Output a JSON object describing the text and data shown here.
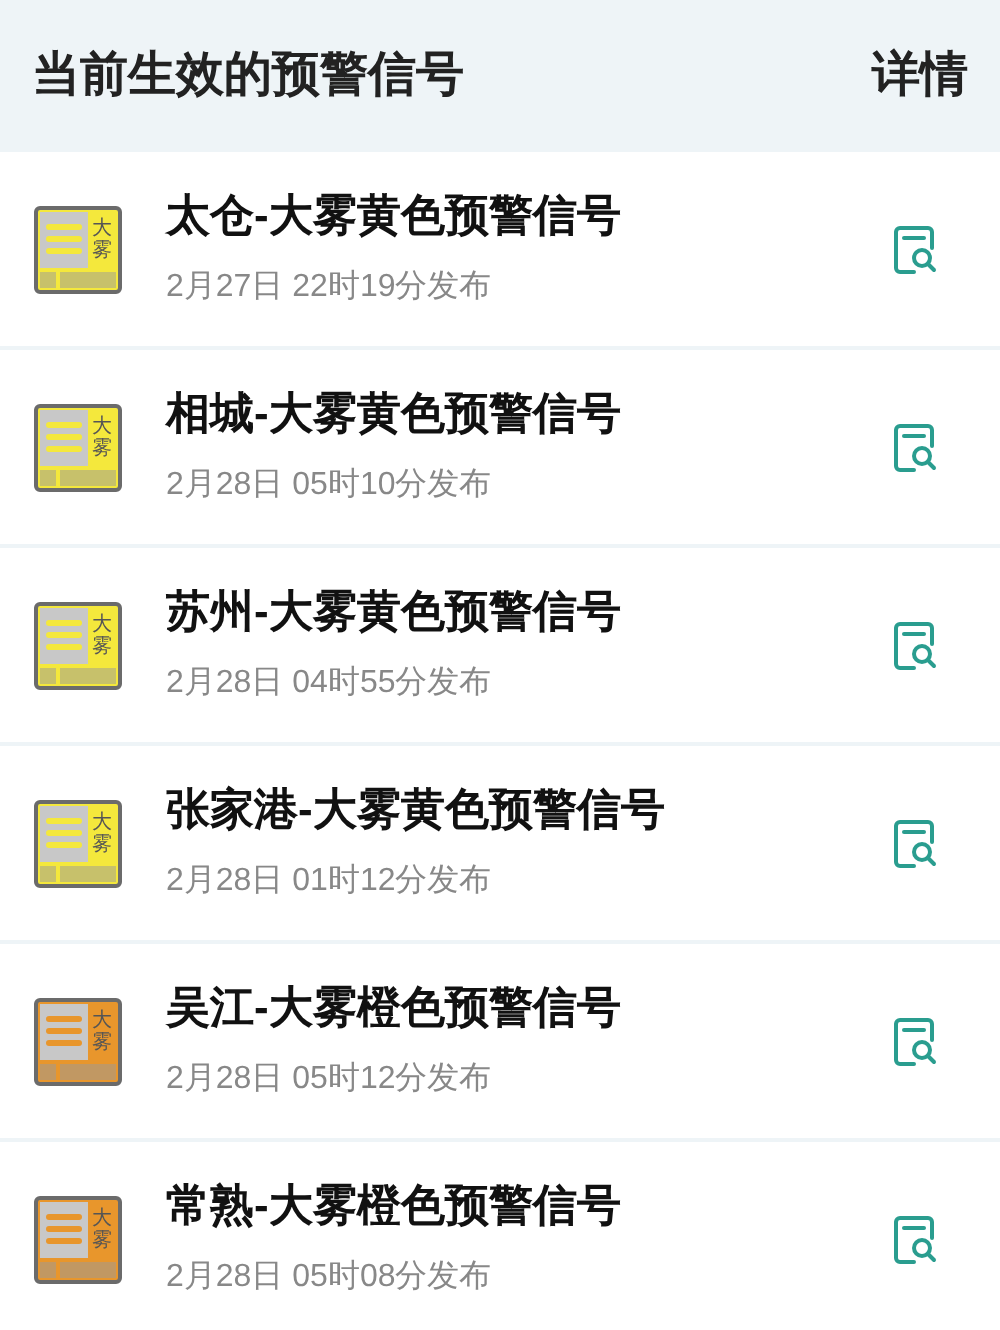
{
  "header": {
    "title": "当前生效的预警信号",
    "action": "详情"
  },
  "warnings": [
    {
      "title": "太仓-大雾黄色预警信号",
      "time": "2月27日 22时19分发布",
      "icon_text": "大雾",
      "color": "#f4e83c"
    },
    {
      "title": "相城-大雾黄色预警信号",
      "time": "2月28日 05时10分发布",
      "icon_text": "大雾",
      "color": "#f4e83c"
    },
    {
      "title": "苏州-大雾黄色预警信号",
      "time": "2月28日 04时55分发布",
      "icon_text": "大雾",
      "color": "#f4e83c"
    },
    {
      "title": "张家港-大雾黄色预警信号",
      "time": "2月28日 01时12分发布",
      "icon_text": "大雾",
      "color": "#f4e83c"
    },
    {
      "title": "吴江-大雾橙色预警信号",
      "time": "2月28日 05时12分发布",
      "icon_text": "大雾",
      "color": "#e8962c"
    },
    {
      "title": "常熟-大雾橙色预警信号",
      "time": "2月28日 05时08分发布",
      "icon_text": "大雾",
      "color": "#e8962c"
    }
  ]
}
